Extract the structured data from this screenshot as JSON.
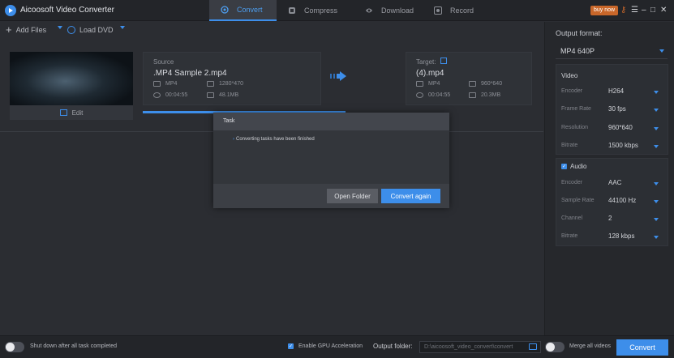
{
  "app": {
    "title": "Aicoosoft Video Converter"
  },
  "tabs": [
    {
      "label": "Convert",
      "icon": "convert-icon",
      "active": true
    },
    {
      "label": "Compress",
      "icon": "compress-icon",
      "active": false
    },
    {
      "label": "Download",
      "icon": "download-icon",
      "active": false
    },
    {
      "label": "Record",
      "icon": "record-icon",
      "active": false
    }
  ],
  "titlebar": {
    "buy_label": "buy now"
  },
  "toolbar": {
    "add_files_label": "Add Files",
    "load_dvd_label": "Load DVD"
  },
  "task": {
    "edit_label": "Edit",
    "source": {
      "label": "Source",
      "filename": ".MP4 Sample 2.mp4",
      "format": "MP4",
      "resolution": "1280*470",
      "duration": "00:04:55",
      "size": "48.1MB"
    },
    "target": {
      "label": "Target:",
      "filename": "(4).mp4",
      "format": "MP4",
      "resolution": "960*640",
      "duration": "00:04:55",
      "size": "20.3MB"
    },
    "progress": 1.0
  },
  "dialog": {
    "title": "Task",
    "message": "Converting tasks have been finished",
    "open_folder_label": "Open Folder",
    "convert_again_label": "Convert again"
  },
  "sidebar": {
    "output_format_label": "Output format:",
    "output_format_value": "MP4 640P",
    "video": {
      "title": "Video",
      "rows": [
        {
          "label": "Encoder",
          "value": "H264"
        },
        {
          "label": "Frame Rate",
          "value": "30 fps"
        },
        {
          "label": "Resolution",
          "value": "960*640"
        },
        {
          "label": "Bitrate",
          "value": "1500 kbps"
        }
      ]
    },
    "audio": {
      "title": "Audio",
      "rows": [
        {
          "label": "Encoder",
          "value": "AAC"
        },
        {
          "label": "Sample Rate",
          "value": "44100 Hz"
        },
        {
          "label": "Channel",
          "value": "2"
        },
        {
          "label": "Bitrate",
          "value": "128 kbps"
        }
      ]
    }
  },
  "bottom": {
    "shutdown_label": "Shut down after all task completed",
    "gpu_label": "Enable GPU Acceleration",
    "output_folder_label": "Output folder:",
    "output_folder_value": "D:\\aicoosoft_video_convert\\convert",
    "merge_label": "Merge all videos",
    "convert_label": "Convert"
  },
  "colors": {
    "accent": "#3d8eea",
    "buy": "#c9672a",
    "background": "#2b2d32"
  }
}
